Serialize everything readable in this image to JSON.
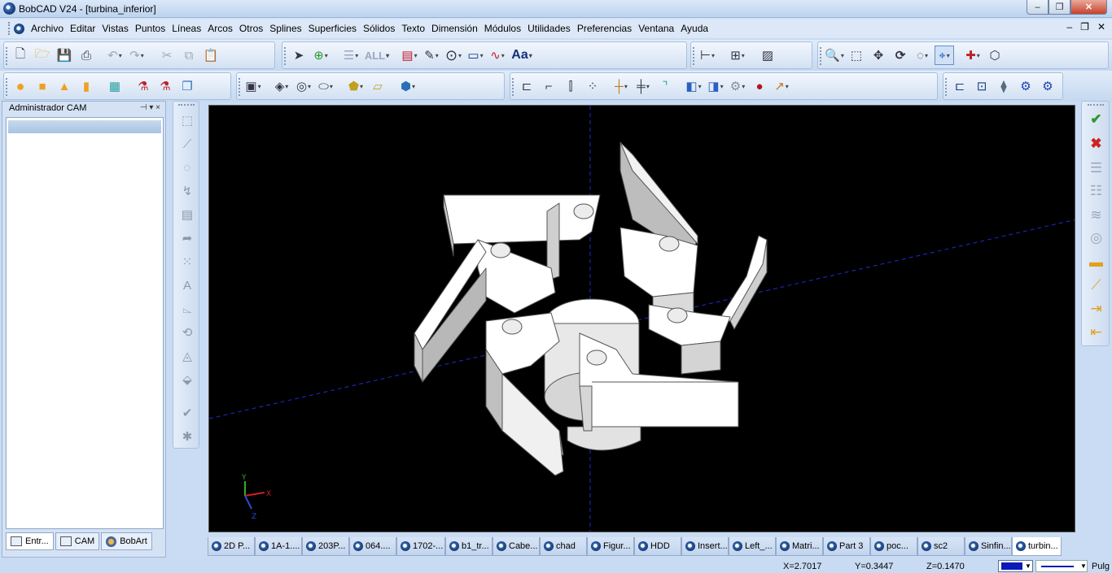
{
  "window": {
    "title": "BobCAD V24 - [turbina_inferior]",
    "min": "‒",
    "max": "❐",
    "close": "✕"
  },
  "menubar": {
    "items": [
      "Archivo",
      "Editar",
      "Vistas",
      "Puntos",
      "Líneas",
      "Arcos",
      "Otros",
      "Splines",
      "Superficies",
      "Sólidos",
      "Texto",
      "Dimensión",
      "Módulos",
      "Utilidades",
      "Preferencias",
      "Ventana",
      "Ayuda"
    ],
    "doc_controls": [
      "‒",
      "❐",
      "✕"
    ]
  },
  "toolbar1": {
    "text_button": "Aa",
    "all_button": "ALL"
  },
  "cam_panel": {
    "title": "Administrador CAM",
    "pin_glyph": "⊣ ▾ ×",
    "tabs": [
      "Entr...",
      "CAM",
      "BobArt"
    ]
  },
  "viewport": {
    "axis_labels": {
      "x": "X",
      "y": "Y",
      "z": "Z"
    },
    "background": "#000000",
    "axis_color": "#1e2bd6"
  },
  "doc_tabs": [
    "2D P...",
    "1A-1....",
    "203P...",
    "064....",
    "1702-...",
    "b1_tr...",
    "Cabe...",
    "chad",
    "Figur...",
    "HDD",
    "Insert...",
    "Left_...",
    "Matri...",
    "Part 3",
    "poc...",
    "sc2",
    "Sinfin...",
    "turbin..."
  ],
  "active_doc_tab": 17,
  "status": {
    "x": "X=2.7017",
    "y": "Y=0.3447",
    "z": "Z=0.1470",
    "units": "Pulg",
    "line_color": "#0a1ab8"
  }
}
